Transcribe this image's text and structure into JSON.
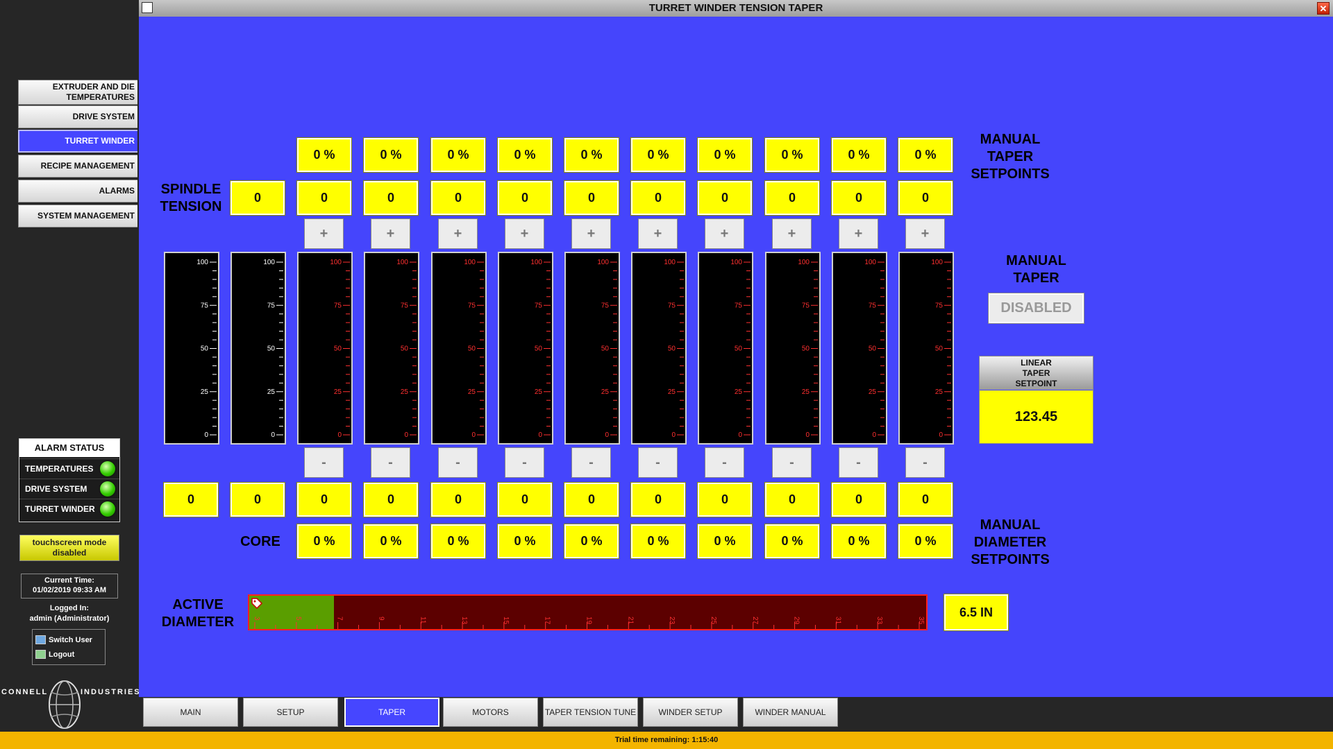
{
  "window": {
    "title": "TURRET WINDER TENSION TAPER"
  },
  "nav": {
    "items": [
      {
        "label": "EXTRUDER AND DIE TEMPERATURES"
      },
      {
        "label": "DRIVE SYSTEM"
      },
      {
        "label": "TURRET WINDER",
        "active": true
      },
      {
        "label": "RECIPE MANAGEMENT"
      },
      {
        "label": "ALARMS"
      },
      {
        "label": "SYSTEM MANAGEMENT"
      }
    ]
  },
  "alarm_status": {
    "title": "ALARM STATUS",
    "rows": [
      {
        "label": "TEMPERATURES",
        "status": "ok"
      },
      {
        "label": "DRIVE SYSTEM",
        "status": "ok"
      },
      {
        "label": "TURRET WINDER",
        "status": "ok"
      }
    ]
  },
  "touchscreen": {
    "label": "touchscreen mode disabled"
  },
  "session": {
    "time_label": "Current Time:",
    "time_value": "01/02/2019 09:33 AM",
    "logged_label": "Logged In:",
    "user": "admin (Administrator)",
    "switch_user": "Switch User",
    "logout": "Logout"
  },
  "logo": {
    "left": "CONNELL",
    "right": "INDUSTRIES"
  },
  "labels": {
    "spindle_tension": "SPINDLE TENSION",
    "core": "CORE",
    "manual_taper_setpoints": "MANUAL TAPER SETPOINTS",
    "manual_taper": "MANUAL TAPER",
    "manual_taper_state": "DISABLED",
    "manual_diameter_setpoints": "MANUAL DIAMETER SETPOINTS",
    "active_diameter": "ACTIVE DIAMETER",
    "linear_taper_setpoint": "LINEAR TAPER SETPOINT",
    "plus": "+",
    "minus": "-"
  },
  "spindle_tension_value": "0",
  "linear_taper_value": "123.45",
  "active_diameter": {
    "value": "6.5 IN",
    "fill_fraction": 0.125,
    "scale_min": 3,
    "scale_max": 35,
    "ticks": [
      "3",
      "5",
      "7",
      "9",
      "11",
      "13",
      "15",
      "17",
      "19",
      "21",
      "23",
      "25",
      "27",
      "29",
      "31",
      "33",
      "35"
    ]
  },
  "gauge_ticks": [
    "100",
    "75",
    "50",
    "25",
    "0"
  ],
  "gauges_left": [
    {
      "bottom_value": "0",
      "level": 0
    },
    {
      "bottom_value": "0",
      "level": 0
    }
  ],
  "taper_columns": [
    {
      "taper_pct": "0 %",
      "tension": "0",
      "bottom": "0",
      "diameter_pct": "0 %",
      "level": 0
    },
    {
      "taper_pct": "0 %",
      "tension": "0",
      "bottom": "0",
      "diameter_pct": "0 %",
      "level": 0
    },
    {
      "taper_pct": "0 %",
      "tension": "0",
      "bottom": "0",
      "diameter_pct": "0 %",
      "level": 0
    },
    {
      "taper_pct": "0 %",
      "tension": "0",
      "bottom": "0",
      "diameter_pct": "0 %",
      "level": 0
    },
    {
      "taper_pct": "0 %",
      "tension": "0",
      "bottom": "0",
      "diameter_pct": "0 %",
      "level": 0
    },
    {
      "taper_pct": "0 %",
      "tension": "0",
      "bottom": "0",
      "diameter_pct": "0 %",
      "level": 0
    },
    {
      "taper_pct": "0 %",
      "tension": "0",
      "bottom": "0",
      "diameter_pct": "0 %",
      "level": 0
    },
    {
      "taper_pct": "0 %",
      "tension": "0",
      "bottom": "0",
      "diameter_pct": "0 %",
      "level": 0
    },
    {
      "taper_pct": "0 %",
      "tension": "0",
      "bottom": "0",
      "diameter_pct": "0 %",
      "level": 0
    },
    {
      "taper_pct": "0 %",
      "tension": "0",
      "bottom": "0",
      "diameter_pct": "0 %",
      "level": 0
    }
  ],
  "tabs": [
    {
      "label": "MAIN"
    },
    {
      "label": "SETUP"
    },
    {
      "label": "TAPER",
      "active": true
    },
    {
      "label": "MOTORS"
    },
    {
      "label": "TAPER TENSION TUNE"
    },
    {
      "label": "WINDER SETUP"
    },
    {
      "label": "WINDER MANUAL"
    }
  ],
  "footer": {
    "trial": "Trial time remaining: 1:15:40"
  },
  "colors": {
    "main_bg": "#4545fc",
    "value_box": "#ffff00",
    "gauge_scale_active": "#ff3030",
    "diameter_fill": "#5a9e00",
    "diameter_track": "#5c0000"
  }
}
